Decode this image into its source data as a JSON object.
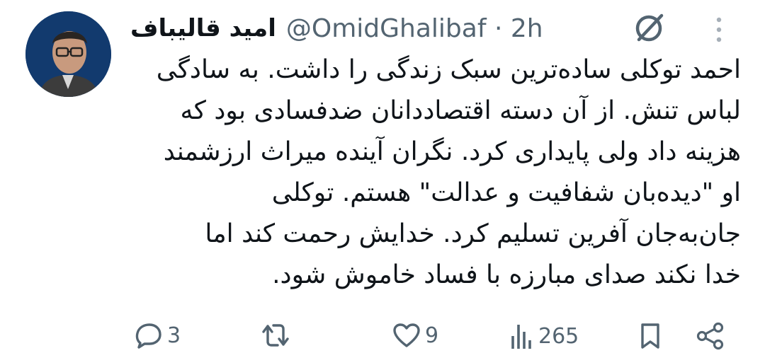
{
  "tweet": {
    "author_name": "امید قالیباف",
    "handle": "@OmidGhalibaf · 2h",
    "text_lines": [
      "احمد توکلی ساده‌ترین سبک زندگی را داشت. به سادگی",
      "لباس تنش. از آن دسته اقتصاددانان ضدفسادی بود که",
      "هزینه داد ولی پایداری کرد. نگران آینده میراث ارزشمند",
      "او \"دیده‌بان شفافیت و عدالت\" هستم. توکلی",
      "جان‌به‌جان آفرین تسلیم کرد. خدایش رحمت کند اما",
      "خدا نکند صدای مبارزه با فساد خاموش شود."
    ]
  },
  "actions": {
    "replies": "3",
    "retweets": "",
    "likes": "9",
    "views": "265"
  },
  "icons": {
    "avatar": "avatar-photo",
    "grok": "grok-icon",
    "more": "more-vertical-icon",
    "reply": "reply-icon",
    "retweet": "retweet-icon",
    "like": "heart-icon",
    "views": "views-icon",
    "bookmark": "bookmark-icon",
    "share": "share-icon"
  },
  "colors": {
    "text": "#0f1419",
    "secondary": "#536471",
    "avatar_bg": "#143a6b"
  }
}
